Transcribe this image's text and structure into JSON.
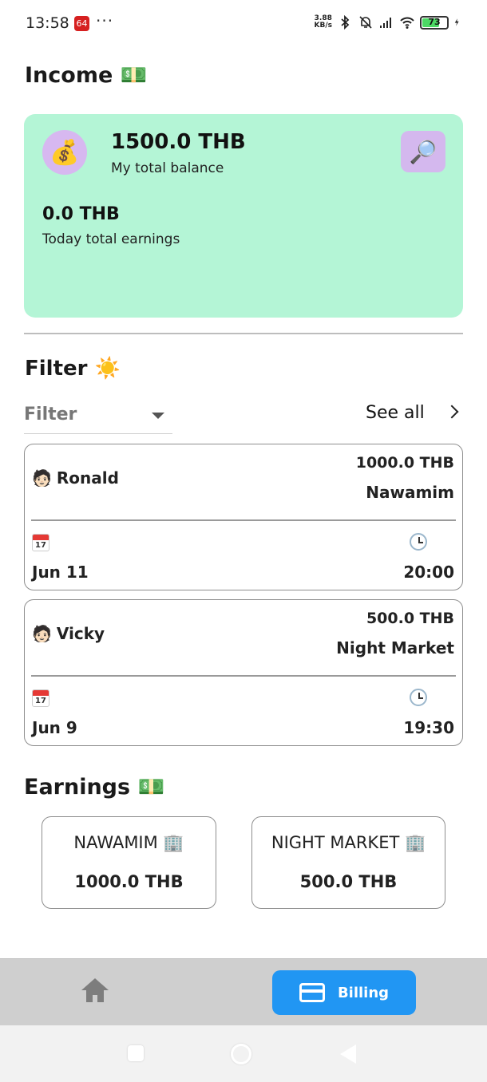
{
  "status_bar": {
    "time": "13:58",
    "app_badge": "64",
    "dots": "···",
    "net_speed_value": "3.88",
    "net_speed_unit": "KB/s",
    "battery_level": "73",
    "battery_fraction": 0.73
  },
  "header": {
    "title": "Income 💵"
  },
  "balance_card": {
    "avatar_emoji": "💰",
    "total_balance": "1500.0 THB",
    "total_balance_label": "My total balance",
    "search_emoji": "🔎",
    "today_earnings": "0.0 THB",
    "today_earnings_label": "Today total earnings"
  },
  "filter": {
    "title": "Filter ☀️",
    "dropdown_value": "Filter",
    "see_all_label": "See all"
  },
  "transactions": [
    {
      "person_emoji": "🧑🏻",
      "name": "Ronald",
      "amount": "1000.0 THB",
      "place": "Nawamim",
      "calendar_day": "17",
      "date": "Jun 11",
      "time": "20:00"
    },
    {
      "person_emoji": "🧑🏻",
      "name": "Vicky",
      "amount": "500.0 THB",
      "place": "Night Market",
      "calendar_day": "17",
      "date": "Jun 9",
      "time": "19:30"
    }
  ],
  "earnings": {
    "title": "Earnings 💵",
    "items": [
      {
        "name": "NAWAMIM 🏢",
        "amount": "1000.0 THB"
      },
      {
        "name": "NIGHT MARKET 🏢",
        "amount": "500.0 THB"
      }
    ]
  },
  "bottom_nav": {
    "billing_label": "Billing",
    "active_color": "#2196f3"
  },
  "colors": {
    "balance_card_bg": "#b4f5d6",
    "avatar_bg": "#d7b8f0"
  }
}
